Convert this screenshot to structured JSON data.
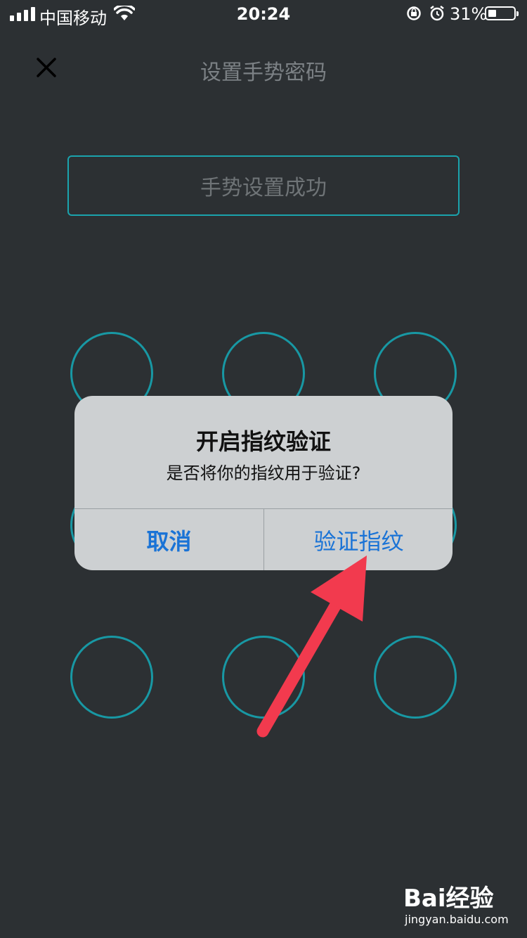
{
  "status_bar": {
    "carrier": "中国移动",
    "time": "20:24",
    "battery_percent": "31%",
    "battery_level": 0.31
  },
  "header": {
    "title": "设置手势密码"
  },
  "message": "手势设置成功",
  "alert": {
    "title": "开启指纹验证",
    "message": "是否将你的指纹用于验证?",
    "cancel_label": "取消",
    "confirm_label": "验证指纹"
  },
  "watermark": {
    "brand": "Bai经验",
    "url": "jingyan.baidu.com"
  },
  "colors": {
    "background": "#2c3033",
    "accent": "#1898a4",
    "alert_button": "#1a73d6",
    "arrow": "#f23a4e"
  },
  "icons": [
    "signal-icon",
    "wifi-icon",
    "rotation-lock-icon",
    "alarm-icon",
    "battery-icon",
    "close-icon",
    "baidu-paw-icon"
  ]
}
